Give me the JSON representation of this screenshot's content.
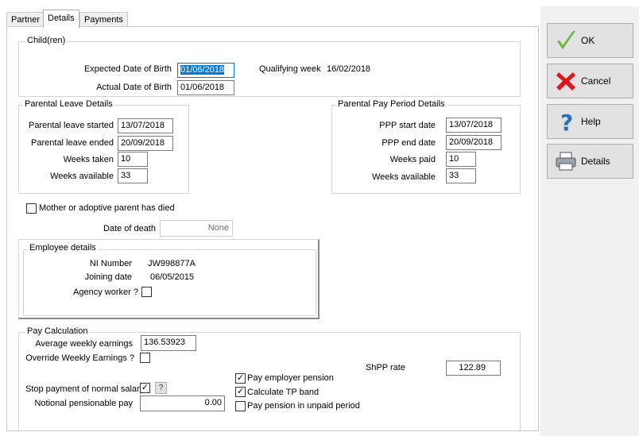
{
  "tabs": [
    {
      "label": "Partner"
    },
    {
      "label": "Details"
    },
    {
      "label": "Payments"
    }
  ],
  "children": {
    "title": "Child(ren)",
    "expected_dob_label": "Expected Date of Birth",
    "expected_dob_value": "01/06/2018",
    "actual_dob_label": "Actual Date of Birth",
    "actual_dob_value": "01/06/2018",
    "qualifying_week_label": "Qualifying week",
    "qualifying_week_value": "16/02/2018"
  },
  "parental_leave": {
    "title": "Parental Leave Details",
    "started_label": "Parental leave started",
    "started_value": "13/07/2018",
    "ended_label": "Parental leave ended",
    "ended_value": "20/09/2018",
    "weeks_taken_label": "Weeks taken",
    "weeks_taken_value": "10",
    "weeks_available_label": "Weeks available",
    "weeks_available_value": "33"
  },
  "parental_pay": {
    "title": "Parental Pay Period Details",
    "start_label": "PPP start date",
    "start_value": "13/07/2018",
    "end_label": "PPP end date",
    "end_value": "20/09/2018",
    "weeks_paid_label": "Weeks paid",
    "weeks_paid_value": "10",
    "weeks_available_label": "Weeks available",
    "weeks_available_value": "33"
  },
  "mother_died": {
    "label": "Mother or adoptive parent has died",
    "checked": false,
    "date_label": "Date of death",
    "date_value": "None"
  },
  "employee": {
    "title": "Employee details",
    "ni_label": "NI Number",
    "ni_value": "JW998877A",
    "joining_label": "Joining date",
    "joining_value": "06/05/2015",
    "agency_label": "Agency worker ?",
    "agency_checked": false
  },
  "pay_calc": {
    "title": "Pay Calculation",
    "awe_label": "Average weekly earnings",
    "awe_value": "136.53923",
    "override_label": "Override Weekly Earnings ?",
    "override_checked": false,
    "shpp_label": "ShPP rate",
    "shpp_value": "122.89",
    "stop_label": "Stop payment of normal salary",
    "stop_checked": true,
    "help_q": "?",
    "notional_label": "Notional pensionable pay",
    "notional_value": "0.00",
    "pay_employer_pension_label": "Pay employer pension",
    "pay_employer_pension_checked": true,
    "calc_tp_band_label": "Calculate TP band",
    "calc_tp_band_checked": true,
    "pay_pension_unpaid_label": "Pay pension in unpaid period",
    "pay_pension_unpaid_checked": false
  },
  "buttons": {
    "ok": {
      "label": "OK",
      "icon": "green-checkmark-icon"
    },
    "cancel": {
      "label": "Cancel",
      "icon": "red-cross-icon"
    },
    "help": {
      "label": "Help",
      "icon": "blue-question-icon"
    },
    "details": {
      "label": "Details",
      "icon": "printer-icon"
    }
  },
  "colors": {
    "ok_green": "#6cb33f",
    "cancel_red": "#d7191c",
    "help_blue": "#2a6fb8",
    "selection": "#0078d7",
    "check_mark": "✓"
  }
}
